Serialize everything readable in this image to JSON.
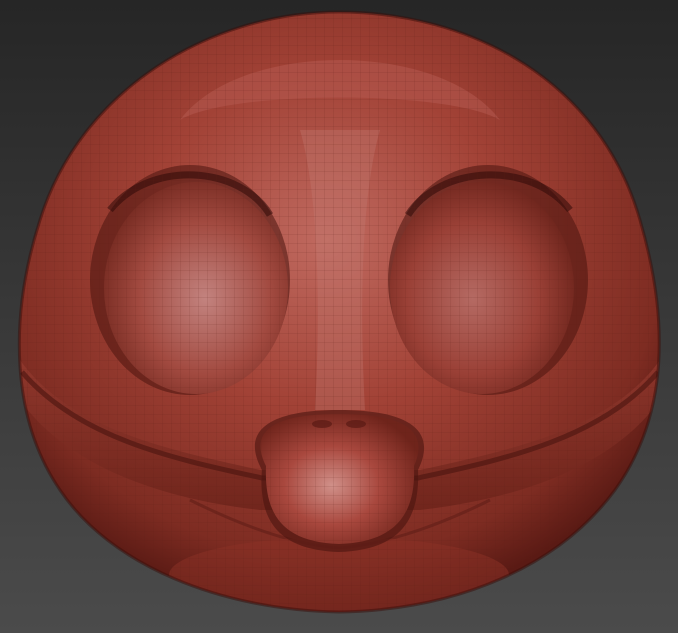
{
  "viewport": {
    "background_top": "#262626",
    "background_bottom": "#4b4b4b"
  },
  "model": {
    "kind": "sculpted-creature-head",
    "material": {
      "base": "#a04035",
      "highlight": "#c98a86",
      "shadow": "#5a1a14",
      "deep_shadow": "#3a0e0a",
      "wireframe": "#7a2820"
    },
    "wireframe_visible": true
  }
}
